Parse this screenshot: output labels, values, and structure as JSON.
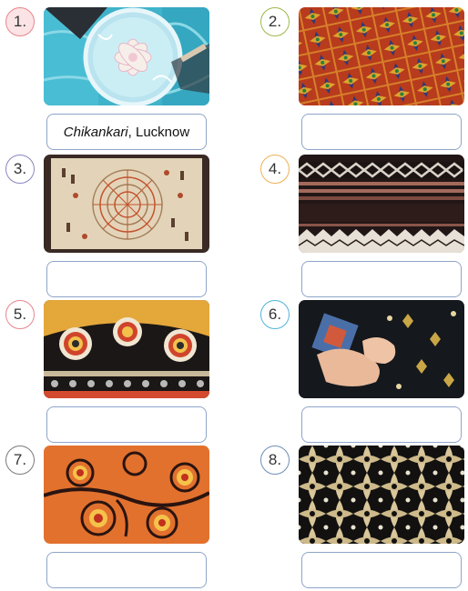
{
  "items": [
    {
      "number": "1.",
      "answer_italic": "Chikankari",
      "answer_rest": ", Lucknow",
      "image": "chikankari-embroidery-hoop"
    },
    {
      "number": "2.",
      "answer_italic": "",
      "answer_rest": "",
      "image": "phulkari-embroidery"
    },
    {
      "number": "3.",
      "answer_italic": "",
      "answer_rest": "",
      "image": "kantha-embroidery"
    },
    {
      "number": "4.",
      "answer_italic": "",
      "answer_rest": "",
      "image": "woven-geometric-textile"
    },
    {
      "number": "5.",
      "answer_italic": "",
      "answer_rest": "",
      "image": "mirror-work-embroidery"
    },
    {
      "number": "6.",
      "answer_italic": "",
      "answer_rest": "",
      "image": "hand-embroidery-black-fabric"
    },
    {
      "number": "7.",
      "answer_italic": "",
      "answer_rest": "",
      "image": "kutch-embroidery"
    },
    {
      "number": "8.",
      "answer_italic": "",
      "answer_rest": "",
      "image": "gold-lattice-embroidery"
    }
  ],
  "colors": {
    "circle_1": "#e8848d",
    "circle_2": "#9cb84a",
    "circle_3": "#8a86c0",
    "circle_4": "#f0b055",
    "circle_5": "#e8848d",
    "circle_6": "#4fb5d8",
    "circle_7": "#7a7a7a",
    "circle_8": "#6f8fb5",
    "answer_border": "#8ea5c9"
  }
}
